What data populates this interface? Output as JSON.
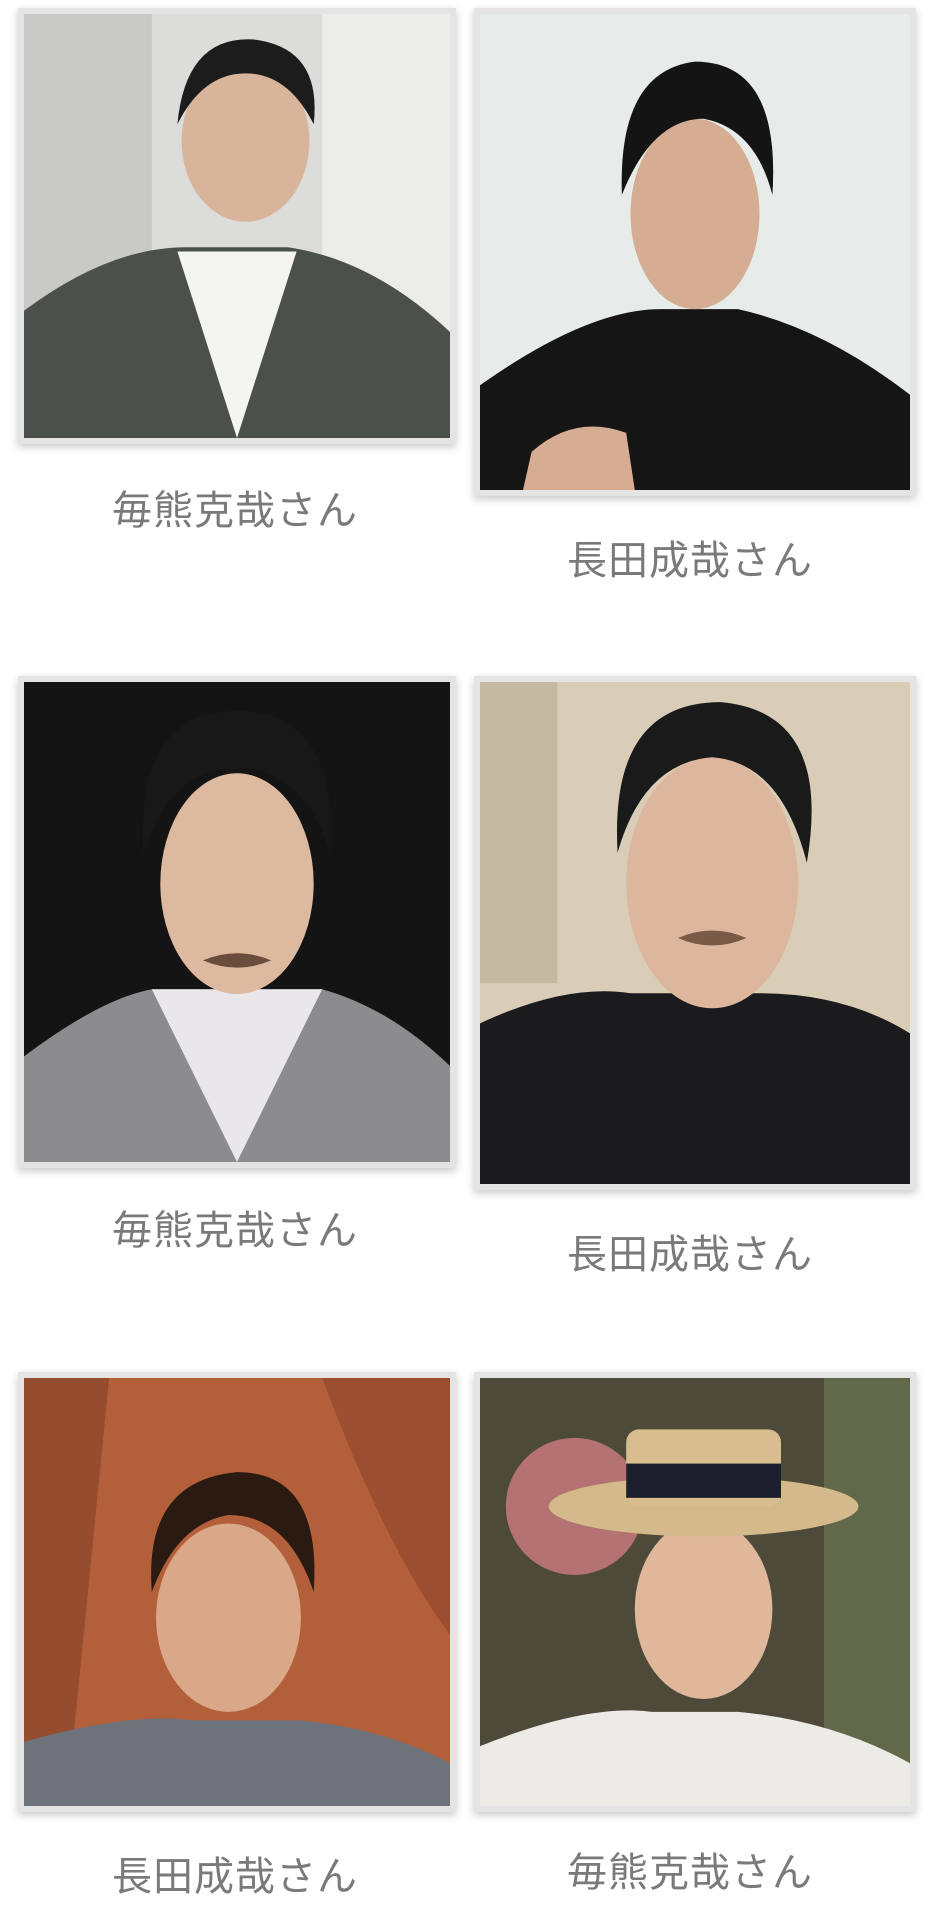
{
  "rows": [
    {
      "left": {
        "caption": "毎熊克哉さん",
        "scene": "gray-wall-jacket"
      },
      "right": {
        "caption": "長田成哉さん",
        "scene": "light-bg-black-top"
      }
    },
    {
      "left": {
        "caption": "毎熊克哉さん",
        "scene": "dark-bg-tweed"
      },
      "right": {
        "caption": "長田成哉さん",
        "scene": "selfie-black-tshirt"
      }
    },
    {
      "left": {
        "caption": "長田成哉さん",
        "scene": "orange-shadow"
      },
      "right": {
        "caption": "毎熊克哉さん",
        "scene": "straw-hat"
      }
    }
  ]
}
